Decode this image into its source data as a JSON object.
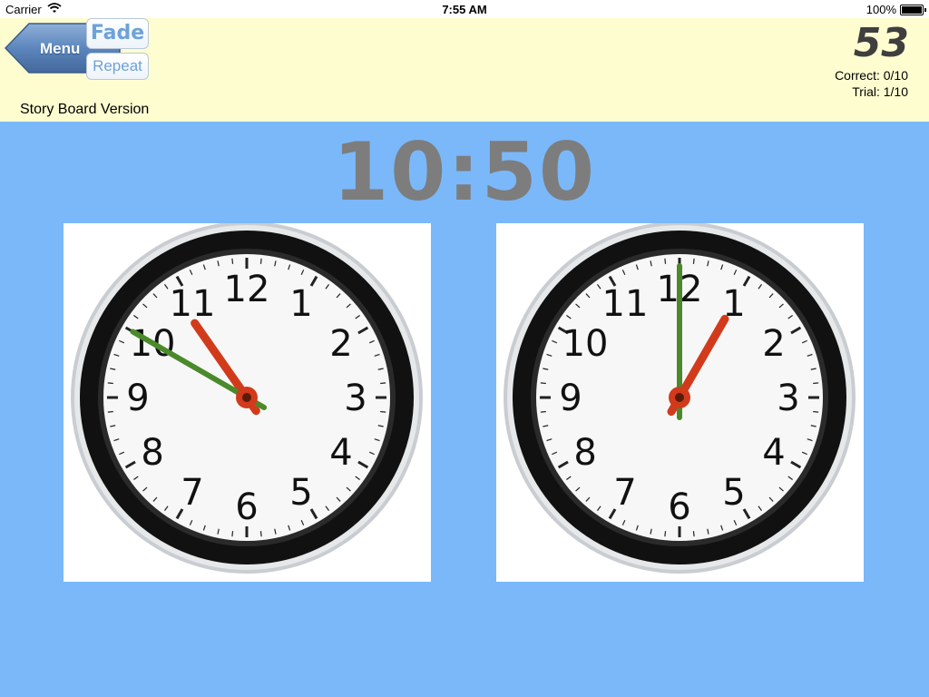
{
  "status": {
    "carrier": "Carrier",
    "time": "7:55 AM",
    "battery": "100%"
  },
  "header": {
    "menu_label": "Menu",
    "fade_label": "Fade",
    "repeat_label": "Repeat",
    "score": "53",
    "correct": "Correct: 0/10",
    "trial": "Trial: 1/10",
    "version": "Story Board Version"
  },
  "target_time": "10:50",
  "clock_numbers": [
    "12",
    "1",
    "2",
    "3",
    "4",
    "5",
    "6",
    "7",
    "8",
    "9",
    "10",
    "11"
  ],
  "clocks": [
    {
      "hour_hand_deg": 325,
      "minute_hand_deg": 300
    },
    {
      "hour_hand_deg": 30,
      "minute_hand_deg": 0
    }
  ],
  "colors": {
    "background": "#7ab8fa",
    "header": "#fefdd0",
    "hour_hand": "#d23a1c",
    "minute_hand": "#4a8a2a",
    "time_text": "#7d7d7d"
  }
}
